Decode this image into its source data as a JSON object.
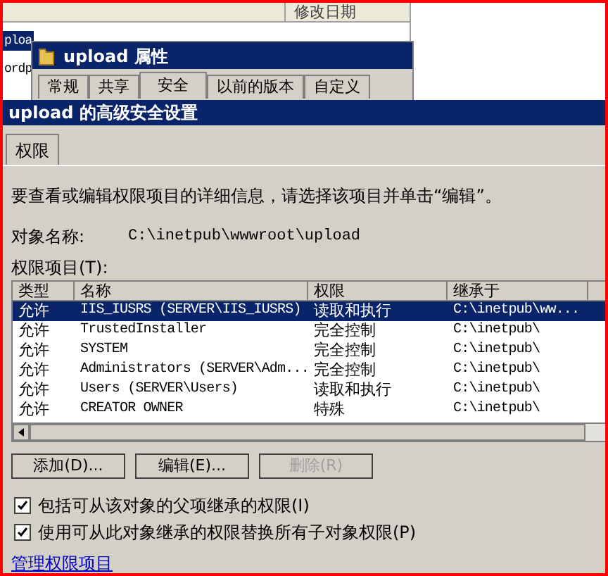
{
  "explorer": {
    "column_header": "修改日期",
    "rows": [
      {
        "name": "ploa",
        "selected": true
      },
      {
        "name": "ordp",
        "selected": false
      }
    ]
  },
  "properties_dialog": {
    "title": "upload 属性",
    "tabs": [
      {
        "label": "常规",
        "selected": false
      },
      {
        "label": "共享",
        "selected": false
      },
      {
        "label": "安全",
        "selected": true
      },
      {
        "label": "以前的版本",
        "selected": false
      },
      {
        "label": "自定义",
        "selected": false
      }
    ]
  },
  "advanced_window": {
    "title": "upload 的高级安全设置",
    "tabs": [
      {
        "label": "权限",
        "selected": true
      }
    ],
    "instructions": "要查看或编辑权限项目的详细信息，请选择该项目并单击“编辑”。",
    "object_name_label": "对象名称:",
    "object_name": "C:\\inetpub\\wwwroot\\upload",
    "entries_label": "权限项目(T):",
    "table": {
      "columns": [
        "类型",
        "名称",
        "权限",
        "继承于"
      ],
      "rows": [
        {
          "cells": [
            "允许",
            "IIS_IUSRS (SERVER\\IIS_IUSRS)",
            "读取和执行",
            "C:\\inetpub\\ww..."
          ],
          "selected": true
        },
        {
          "cells": [
            "允许",
            "TrustedInstaller",
            "完全控制",
            "C:\\inetpub\\"
          ],
          "selected": false
        },
        {
          "cells": [
            "允许",
            "SYSTEM",
            "完全控制",
            "C:\\inetpub\\"
          ],
          "selected": false
        },
        {
          "cells": [
            "允许",
            "Administrators (SERVER\\Adm...",
            "完全控制",
            "C:\\inetpub\\"
          ],
          "selected": false
        },
        {
          "cells": [
            "允许",
            "Users (SERVER\\Users)",
            "读取和执行",
            "C:\\inetpub\\"
          ],
          "selected": false
        },
        {
          "cells": [
            "允许",
            "CREATOR OWNER",
            "特殊",
            "C:\\inetpub\\"
          ],
          "selected": false
        }
      ]
    },
    "buttons": [
      {
        "label": "添加(D)...",
        "disabled": false
      },
      {
        "label": "编辑(E)...",
        "disabled": false
      },
      {
        "label": "删除(R)",
        "disabled": true
      }
    ],
    "checkboxes": [
      {
        "label": "包括可从该对象的父项继承的权限(I)",
        "checked": true
      },
      {
        "label": "使用可从此对象继承的权限替换所有子对象权限(P)",
        "checked": true
      }
    ],
    "link": "管理权限项目"
  }
}
